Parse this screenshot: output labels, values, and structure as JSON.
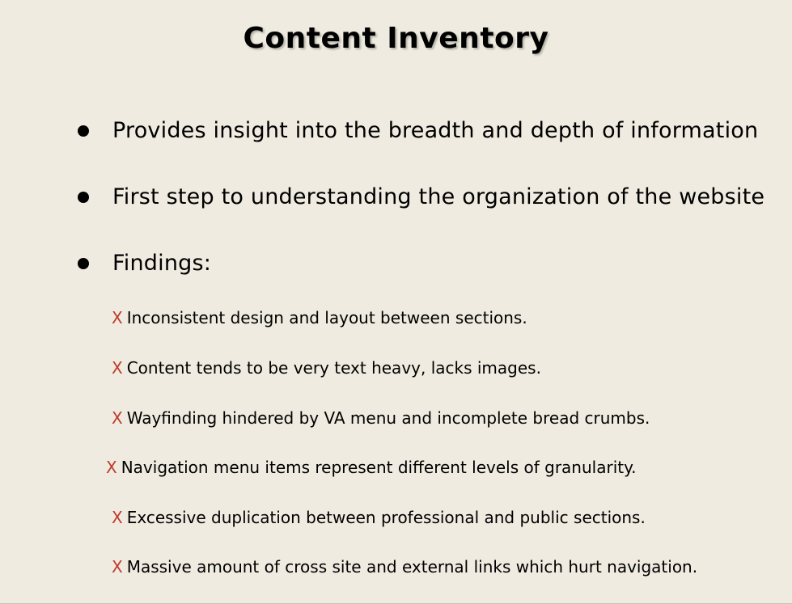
{
  "slide": {
    "title": "Content Inventory",
    "bullets": [
      {
        "text": "Provides insight into the breadth and depth of information"
      },
      {
        "text": "First step to understanding the organization of the website"
      },
      {
        "text": "Findings:"
      }
    ],
    "findings_marker": "X",
    "findings": [
      {
        "text": "Inconsistent design and layout between sections."
      },
      {
        "text": "Content tends to be very text heavy, lacks images."
      },
      {
        "text": "Wayfinding hindered by VA menu and incomplete bread crumbs."
      },
      {
        "text": "Navigation menu items represent different levels of granularity."
      },
      {
        "text": "Excessive duplication between professional and public sections."
      },
      {
        "text": "Massive amount of cross site and external links which hurt navigation."
      }
    ]
  },
  "colors": {
    "background": "#efebe0",
    "marker": "#c0392b",
    "text": "#000000"
  }
}
